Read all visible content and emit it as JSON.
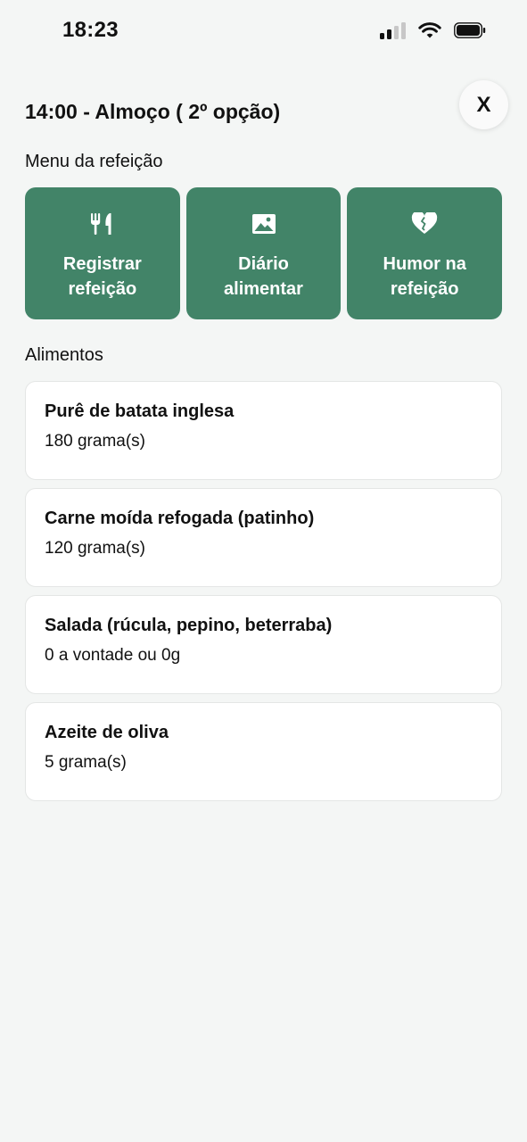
{
  "colors": {
    "accent": "#428468",
    "background": "#f4f6f5"
  },
  "status_bar": {
    "time": "18:23",
    "icons": [
      "signal-icon",
      "wifi-icon",
      "battery-icon"
    ]
  },
  "header": {
    "title": "14:00 - Almoço ( 2º opção)",
    "close_label": "X"
  },
  "menu": {
    "section_label": "Menu da refeição",
    "items": [
      {
        "icon": "fork-knife-icon",
        "label": "Registrar\nrefeição"
      },
      {
        "icon": "image-icon",
        "label": "Diário\nalimentar"
      },
      {
        "icon": "heart-icon",
        "label": "Humor na\nrefeição"
      }
    ]
  },
  "foods": {
    "section_label": "Alimentos",
    "items": [
      {
        "name": "Purê de batata inglesa",
        "quantity": "180 grama(s)"
      },
      {
        "name": "Carne moída refogada (patinho)",
        "quantity": "120 grama(s)"
      },
      {
        "name": "Salada (rúcula, pepino, beterraba)",
        "quantity": "0 a vontade ou 0g"
      },
      {
        "name": "Azeite de oliva",
        "quantity": "5 grama(s)"
      }
    ]
  }
}
